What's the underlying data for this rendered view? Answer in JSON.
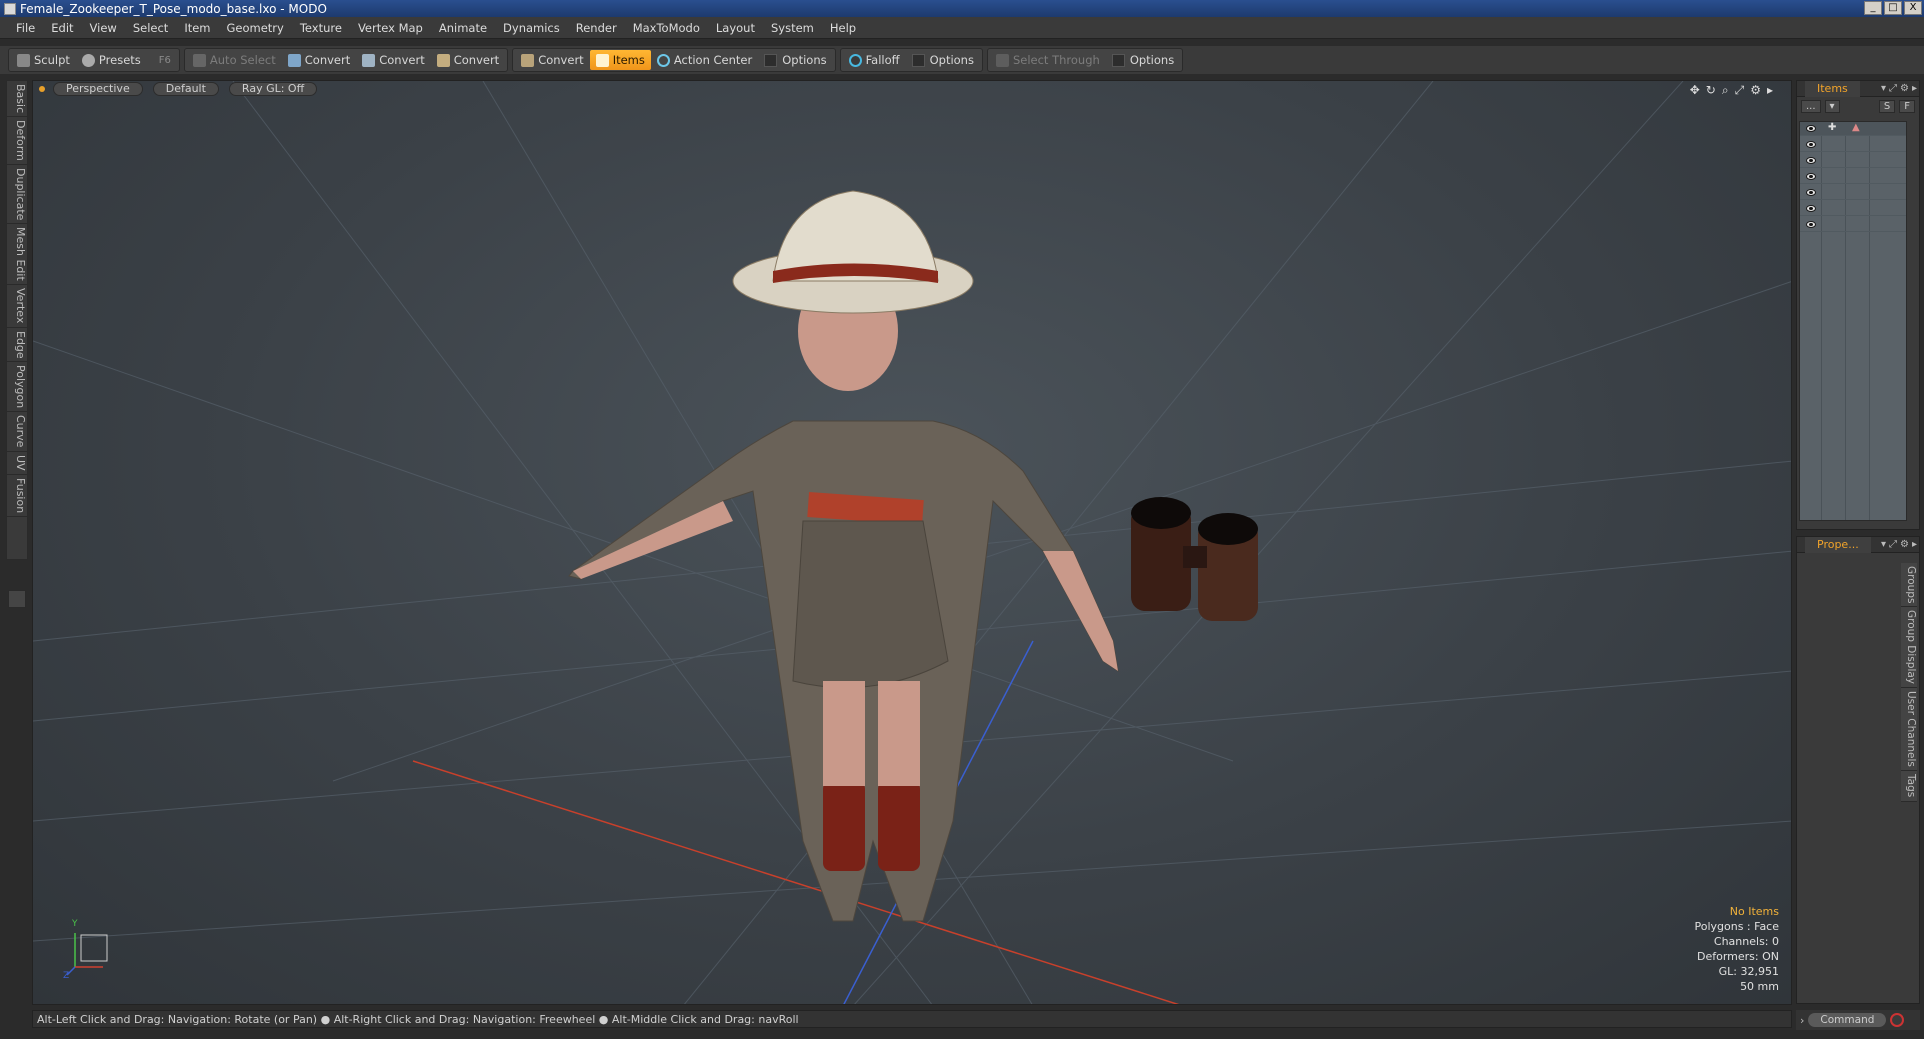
{
  "window": {
    "title": "Female_Zookeeper_T_Pose_modo_base.lxo - MODO",
    "min": "_",
    "max": "□",
    "close": "X"
  },
  "menu": [
    "File",
    "Edit",
    "View",
    "Select",
    "Item",
    "Geometry",
    "Texture",
    "Vertex Map",
    "Animate",
    "Dynamics",
    "Render",
    "MaxToModo",
    "Layout",
    "System",
    "Help"
  ],
  "toolbar": {
    "sculpt": "Sculpt",
    "presets": "Presets",
    "presets_key": "F6",
    "auto_select": "Auto Select",
    "convert": "Convert",
    "items": "Items",
    "action_center": "Action Center",
    "options": "Options",
    "falloff": "Falloff",
    "select_through": "Select Through"
  },
  "left_tabs": [
    "Basic",
    "Deform",
    "Duplicate",
    "Mesh Edit",
    "Vertex",
    "Edge",
    "Polygon",
    "Curve",
    "UV",
    "Fusion"
  ],
  "viewport": {
    "view": "Perspective",
    "shading": "Default",
    "raygl": "Ray GL: Off",
    "stats": {
      "items": "No Items",
      "polygons": "Polygons : Face",
      "channels": "Channels: 0",
      "deformers": "Deformers: ON",
      "gl": "GL: 32,951",
      "lens": "50 mm"
    },
    "axis_y": "Y",
    "axis_z": "Z"
  },
  "status": "Alt-Left Click and Drag: Navigation: Rotate (or Pan) ● Alt-Right Click and Drag: Navigation: Freewheel ● Alt-Middle Click and Drag: navRoll",
  "items_panel": {
    "tab": "Items",
    "btn1": "...",
    "btn_s": "S",
    "btn_f": "F",
    "rows": 6
  },
  "properties_panel": {
    "tab": "Prope...",
    "vtabs": [
      "Groups",
      "Group Display",
      "User Channels",
      "Tags"
    ]
  },
  "command": {
    "placeholder": "Command"
  },
  "colors": {
    "accent": "#f0951a",
    "tab_text": "#f2a42a",
    "axis_x": "#c8402b",
    "axis_z": "#3a5fd0"
  }
}
